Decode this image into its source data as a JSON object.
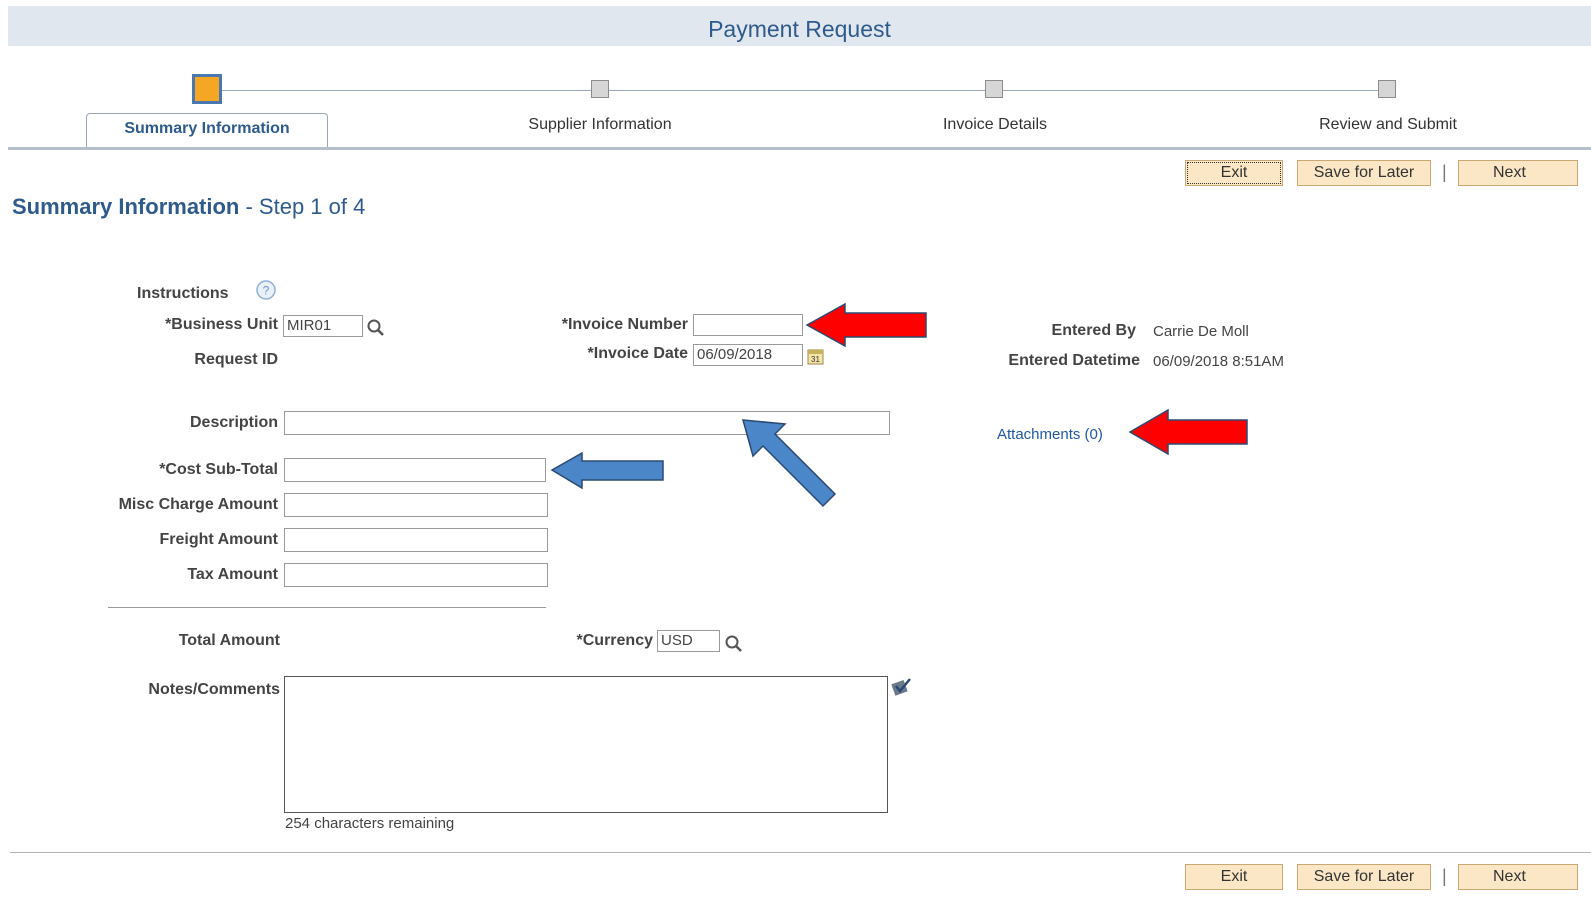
{
  "page": {
    "title": "Payment Request"
  },
  "steps": [
    {
      "label": "Summary Information",
      "active": true
    },
    {
      "label": "Supplier Information",
      "active": false
    },
    {
      "label": "Invoice Details",
      "active": false
    },
    {
      "label": "Review and Submit",
      "active": false
    }
  ],
  "toolbar": {
    "exit": "Exit",
    "save_later": "Save for Later",
    "next": "Next",
    "separator": "|"
  },
  "heading": {
    "title": "Summary Information",
    "step": " - Step 1 of 4"
  },
  "form": {
    "instructions": "Instructions",
    "business_unit": {
      "label": "*Business Unit",
      "value": "MIR01"
    },
    "request_id": {
      "label": "Request ID",
      "value": ""
    },
    "invoice_number": {
      "label": "*Invoice Number",
      "value": ""
    },
    "invoice_date": {
      "label": "*Invoice Date",
      "value": "06/09/2018"
    },
    "entered_by": {
      "label": "Entered By",
      "value": "Carrie De Moll"
    },
    "entered_datetime": {
      "label": "Entered Datetime",
      "value": "06/09/2018  8:51AM"
    },
    "description": {
      "label": "Description",
      "value": ""
    },
    "attachments": "Attachments (0)",
    "cost_subtotal": {
      "label": "*Cost Sub-Total",
      "value": ""
    },
    "misc_charge": {
      "label": "Misc Charge Amount",
      "value": ""
    },
    "freight": {
      "label": "Freight Amount",
      "value": ""
    },
    "tax": {
      "label": "Tax Amount",
      "value": ""
    },
    "total": {
      "label": "Total Amount",
      "value": ""
    },
    "currency": {
      "label": "*Currency",
      "value": "USD"
    },
    "notes": {
      "label": "Notes/Comments",
      "value": "",
      "remaining": "254 characters remaining"
    }
  },
  "colors": {
    "accent": "#2e5a8c",
    "button_bg": "#fbe7c6",
    "red_arrow": "#ff0000",
    "blue_arrow": "#4a86c8",
    "active_step": "#f5a623"
  },
  "icons": [
    "help-icon",
    "lookup-icon",
    "calendar-icon",
    "spellcheck-icon",
    "red-arrow-annotation",
    "blue-arrow-annotation"
  ]
}
